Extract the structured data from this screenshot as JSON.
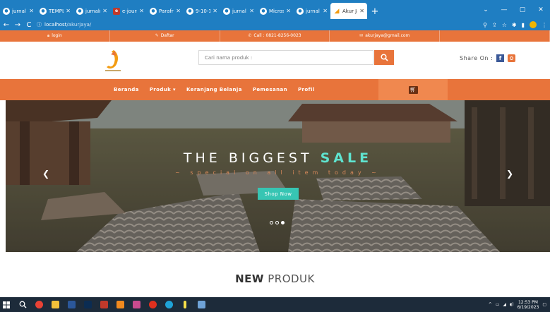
{
  "browser": {
    "tabs": [
      {
        "label": "jurnal ti",
        "icon": "globe-icon",
        "active": false
      },
      {
        "label": "TEMPLA",
        "icon": "globe-icon",
        "active": false
      },
      {
        "label": "jurnalm",
        "icon": "globe-icon",
        "active": false
      },
      {
        "label": "e-journ",
        "icon": "doc-icon",
        "active": false
      },
      {
        "label": "Parafras",
        "icon": "globe-icon",
        "active": false
      },
      {
        "label": "9-10-1",
        "icon": "globe-icon",
        "active": false
      },
      {
        "label": "jurnal",
        "icon": "globe-icon",
        "active": false
      },
      {
        "label": "Microso",
        "icon": "globe-icon",
        "active": false
      },
      {
        "label": "jurnal",
        "icon": "globe-icon",
        "active": false
      },
      {
        "label": "Akur Ja",
        "icon": "akurjaya-icon",
        "active": true
      }
    ],
    "new_tab": "+",
    "url_host": "localhost",
    "url_path": "/akurjaya/",
    "back": "←",
    "forward": "→",
    "reload": "C",
    "info": "ⓘ"
  },
  "topbar": {
    "login": "login",
    "daftar": "Daftar",
    "call": "Call : 0821-8256-0023",
    "email": "akurjaya@gmail.com"
  },
  "header": {
    "search_placeholder": "Cari nama produk :",
    "share_label": "Share On :",
    "facebook": "f"
  },
  "nav": {
    "items": [
      {
        "label": "Beranda"
      },
      {
        "label": "Produk ▾"
      },
      {
        "label": "Keranjang Belanja"
      },
      {
        "label": "Pemesanan"
      },
      {
        "label": "Profil"
      }
    ]
  },
  "hero": {
    "title_pre": "THE BIGGEST ",
    "title_sale": "SALE",
    "subtitle": "~ special on all item today ~",
    "button": "Shop Now",
    "prev": "❮",
    "next": "❯",
    "slides": 3,
    "active_slide": 3
  },
  "section": {
    "bold": "NEW",
    "rest": " PRODUK"
  },
  "taskbar": {
    "time": "12:53 PM",
    "date": "6/19/2023"
  },
  "colors": {
    "brand_orange": "#e8743b",
    "browser_blue": "#1f7ec2",
    "accent_teal": "#37c5b3"
  }
}
